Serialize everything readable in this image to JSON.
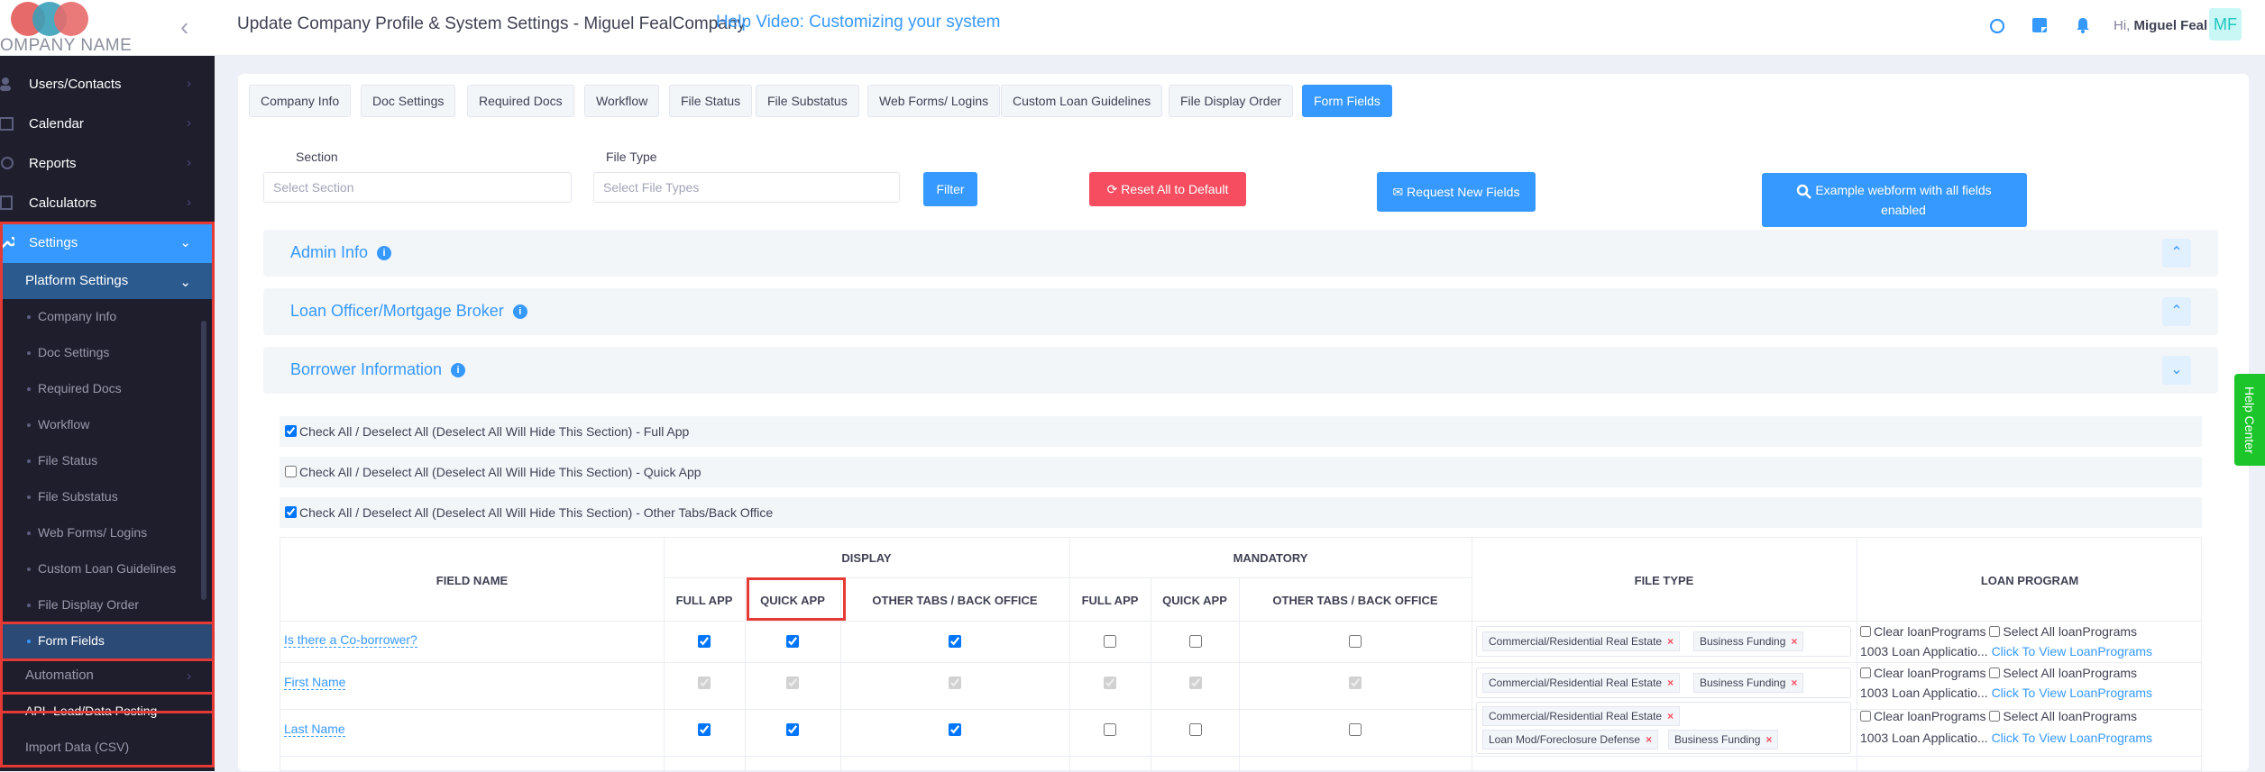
{
  "header": {
    "company_name": "OMPANY NAME",
    "title": "Update Company Profile & System Settings - Miguel FealCompany",
    "help_video": "Help Video: Customizing your system",
    "greeting_prefix": "Hi,",
    "user_name": "Miguel Feal",
    "avatar_initials": "MF"
  },
  "sidebar": {
    "items": [
      {
        "label": "Users/Contacts",
        "icon": "users-icon"
      },
      {
        "label": "Calendar",
        "icon": "calendar-icon"
      },
      {
        "label": "Reports",
        "icon": "reports-icon"
      },
      {
        "label": "Calculators",
        "icon": "calculator-icon"
      },
      {
        "label": "Settings",
        "icon": "wrench-icon"
      }
    ],
    "platform_settings": "Platform Settings",
    "sub_items": [
      "Company Info",
      "Doc Settings",
      "Required Docs",
      "Workflow",
      "File Status",
      "File Substatus",
      "Web Forms/ Logins",
      "Custom Loan Guidelines",
      "File Display Order",
      "Form Fields"
    ],
    "automation": "Automation",
    "api": "API- Lead/Data Posting",
    "import": "Import Data (CSV)"
  },
  "tabs": [
    "Company Info",
    "Doc Settings",
    "Required Docs",
    "Workflow",
    "File Status",
    "File Substatus",
    "Web Forms/ Logins",
    "Custom Loan Guidelines",
    "File Display Order",
    "Form Fields"
  ],
  "filters": {
    "section_label": "Section",
    "section_placeholder": "Select Section",
    "filetype_label": "File Type",
    "filetype_placeholder": "Select File Types",
    "filter_btn": "Filter",
    "reset_btn": "Reset All to Default",
    "request_btn": "Request New Fields",
    "example_btn": "Example webform with all fields enabled"
  },
  "sections": {
    "admin": "Admin Info",
    "loan_officer": "Loan Officer/Mortgage Broker",
    "borrower": "Borrower Information"
  },
  "check_rows": [
    {
      "label": "Check All / Deselect All (Deselect All Will Hide This Section) - Full App",
      "checked": true
    },
    {
      "label": "Check All / Deselect All (Deselect All Will Hide This Section) - Quick App",
      "checked": false
    },
    {
      "label": "Check All / Deselect All (Deselect All Will Hide This Section) - Other Tabs/Back Office",
      "checked": true
    }
  ],
  "table": {
    "headers": {
      "field_name": "FIELD NAME",
      "display": "DISPLAY",
      "mandatory": "MANDATORY",
      "file_type": "FILE TYPE",
      "loan_program": "LOAN PROGRAM",
      "full_app": "FULL APP",
      "quick_app": "QUICK APP",
      "other_tabs": "OTHER TABS / BACK OFFICE"
    },
    "rows": [
      {
        "field": "Is there a Co-borrower?",
        "display": [
          true,
          true,
          true
        ],
        "mandatory": [
          false,
          false,
          false
        ],
        "disabled": false,
        "chips": [
          "Commercial/Residential Real Estate",
          "Business Funding"
        ]
      },
      {
        "field": "First Name",
        "display": [
          true,
          true,
          true
        ],
        "mandatory": [
          true,
          true,
          true
        ],
        "disabled": true,
        "chips": [
          "Commercial/Residential Real Estate",
          "Business Funding"
        ]
      },
      {
        "field": "Last Name",
        "display": [
          true,
          true,
          true
        ],
        "mandatory": [
          false,
          false,
          false
        ],
        "disabled": false,
        "chips": [
          "Commercial/Residential Real Estate",
          "Loan Mod/Foreclosure Defense",
          "Business Funding"
        ]
      }
    ],
    "loan_program": {
      "clear": "Clear loanPrograms",
      "select_all": "Select All loanPrograms",
      "prefix": "1003 Loan Applicatio...",
      "link": "Click To View LoanPrograms"
    }
  },
  "help_center": "Help Center"
}
